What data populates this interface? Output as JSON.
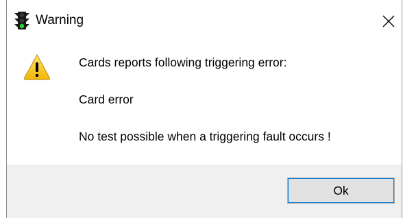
{
  "window": {
    "title": "Warning",
    "title_icon": "traffic-light-icon",
    "close_icon": "close-icon"
  },
  "message": {
    "icon": "warning-triangle-icon",
    "line1": "Cards reports following triggering error:",
    "line2": "Card error",
    "line3": "No test possible when a triggering fault occurs !"
  },
  "buttons": {
    "ok_label": "Ok"
  },
  "colors": {
    "footer_bg": "#f0f0f0",
    "button_bg": "#e1e1e1",
    "focus_outline": "#0078d7",
    "warning_yellow": "#f4c60a"
  }
}
